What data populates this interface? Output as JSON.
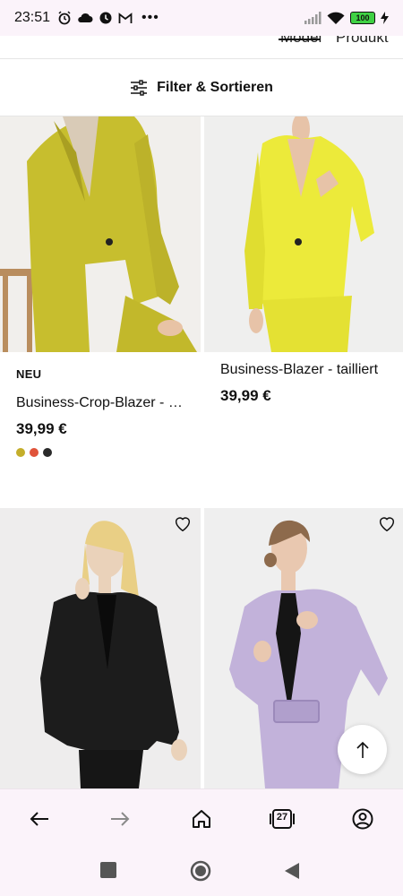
{
  "status_bar": {
    "time": "23:51",
    "left_icons": [
      "alarm-icon",
      "cloud-icon",
      "clock-icon",
      "gmail-icon",
      "more-dots-icon"
    ],
    "battery_level": "100",
    "right_icons": [
      "signal-icon",
      "wifi-icon",
      "battery-icon",
      "charging-icon"
    ]
  },
  "top_tabs": {
    "left_partial": "Model",
    "right_partial": "Produkt",
    "active": "Model"
  },
  "filter": {
    "label": "Filter & Sortieren",
    "icon": "sliders-icon"
  },
  "products": [
    {
      "badge": "NEU",
      "name": "Business-Crop-Blazer - Re…",
      "price": "39,99 €",
      "swatches": [
        "#c4ae2b",
        "#e0533a",
        "#2a2a2a"
      ],
      "image_colors": {
        "bg": "#f1efec",
        "item": "#c7be2e"
      }
    },
    {
      "badge": "",
      "name": "Business-Blazer - tailliert",
      "price": "39,99 €",
      "swatches": [],
      "image_colors": {
        "bg": "#efefee",
        "item": "#ecea3a"
      }
    },
    {
      "badge": "",
      "name": "",
      "price": "",
      "swatches": [],
      "image_colors": {
        "bg": "#eeeded",
        "item": "#1c1c1c"
      }
    },
    {
      "badge": "",
      "name": "",
      "price": "",
      "swatches": [],
      "image_colors": {
        "bg": "#efefef",
        "item": "#c2b2da"
      }
    }
  ],
  "scroll_top_icon": "arrow-up-icon",
  "browser_nav": {
    "icons": [
      "back-arrow-icon",
      "forward-arrow-icon",
      "home-icon",
      "tabs-icon",
      "account-icon"
    ],
    "tab_count": "27"
  },
  "system_nav": {
    "icons": [
      "recents-square-icon",
      "home-circle-icon",
      "back-triangle-icon"
    ]
  }
}
